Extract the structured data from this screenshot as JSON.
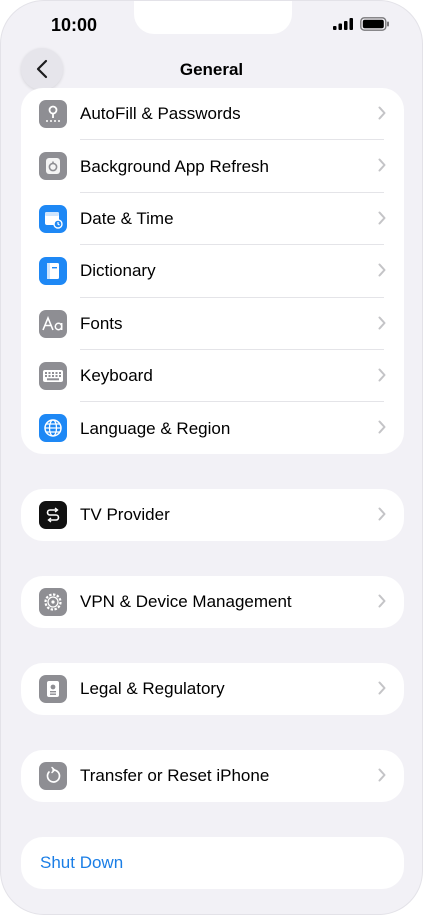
{
  "status": {
    "time": "10:00"
  },
  "header": {
    "title": "General"
  },
  "groups": {
    "main": [
      {
        "label": "AutoFill & Passwords",
        "icon": "key-icon"
      },
      {
        "label": "Background App Refresh",
        "icon": "refresh-icon"
      },
      {
        "label": "Date & Time",
        "icon": "calendar-clock-icon"
      },
      {
        "label": "Dictionary",
        "icon": "book-icon"
      },
      {
        "label": "Fonts",
        "icon": "fonts-icon"
      },
      {
        "label": "Keyboard",
        "icon": "keyboard-icon"
      },
      {
        "label": "Language & Region",
        "icon": "globe-icon"
      }
    ],
    "tv": {
      "label": "TV Provider",
      "icon": "tv-provider-icon"
    },
    "vpn": {
      "label": "VPN & Device Management",
      "icon": "gear-icon"
    },
    "legal": {
      "label": "Legal & Regulatory",
      "icon": "document-icon"
    },
    "transfer": {
      "label": "Transfer or Reset iPhone",
      "icon": "reset-icon"
    },
    "shutdown": {
      "label": "Shut Down"
    }
  },
  "colors": {
    "accent": "#1a7ee6",
    "background": "#f2f1f6",
    "icon_grey": "#8e8e93",
    "icon_blue": "#1e88f5"
  }
}
